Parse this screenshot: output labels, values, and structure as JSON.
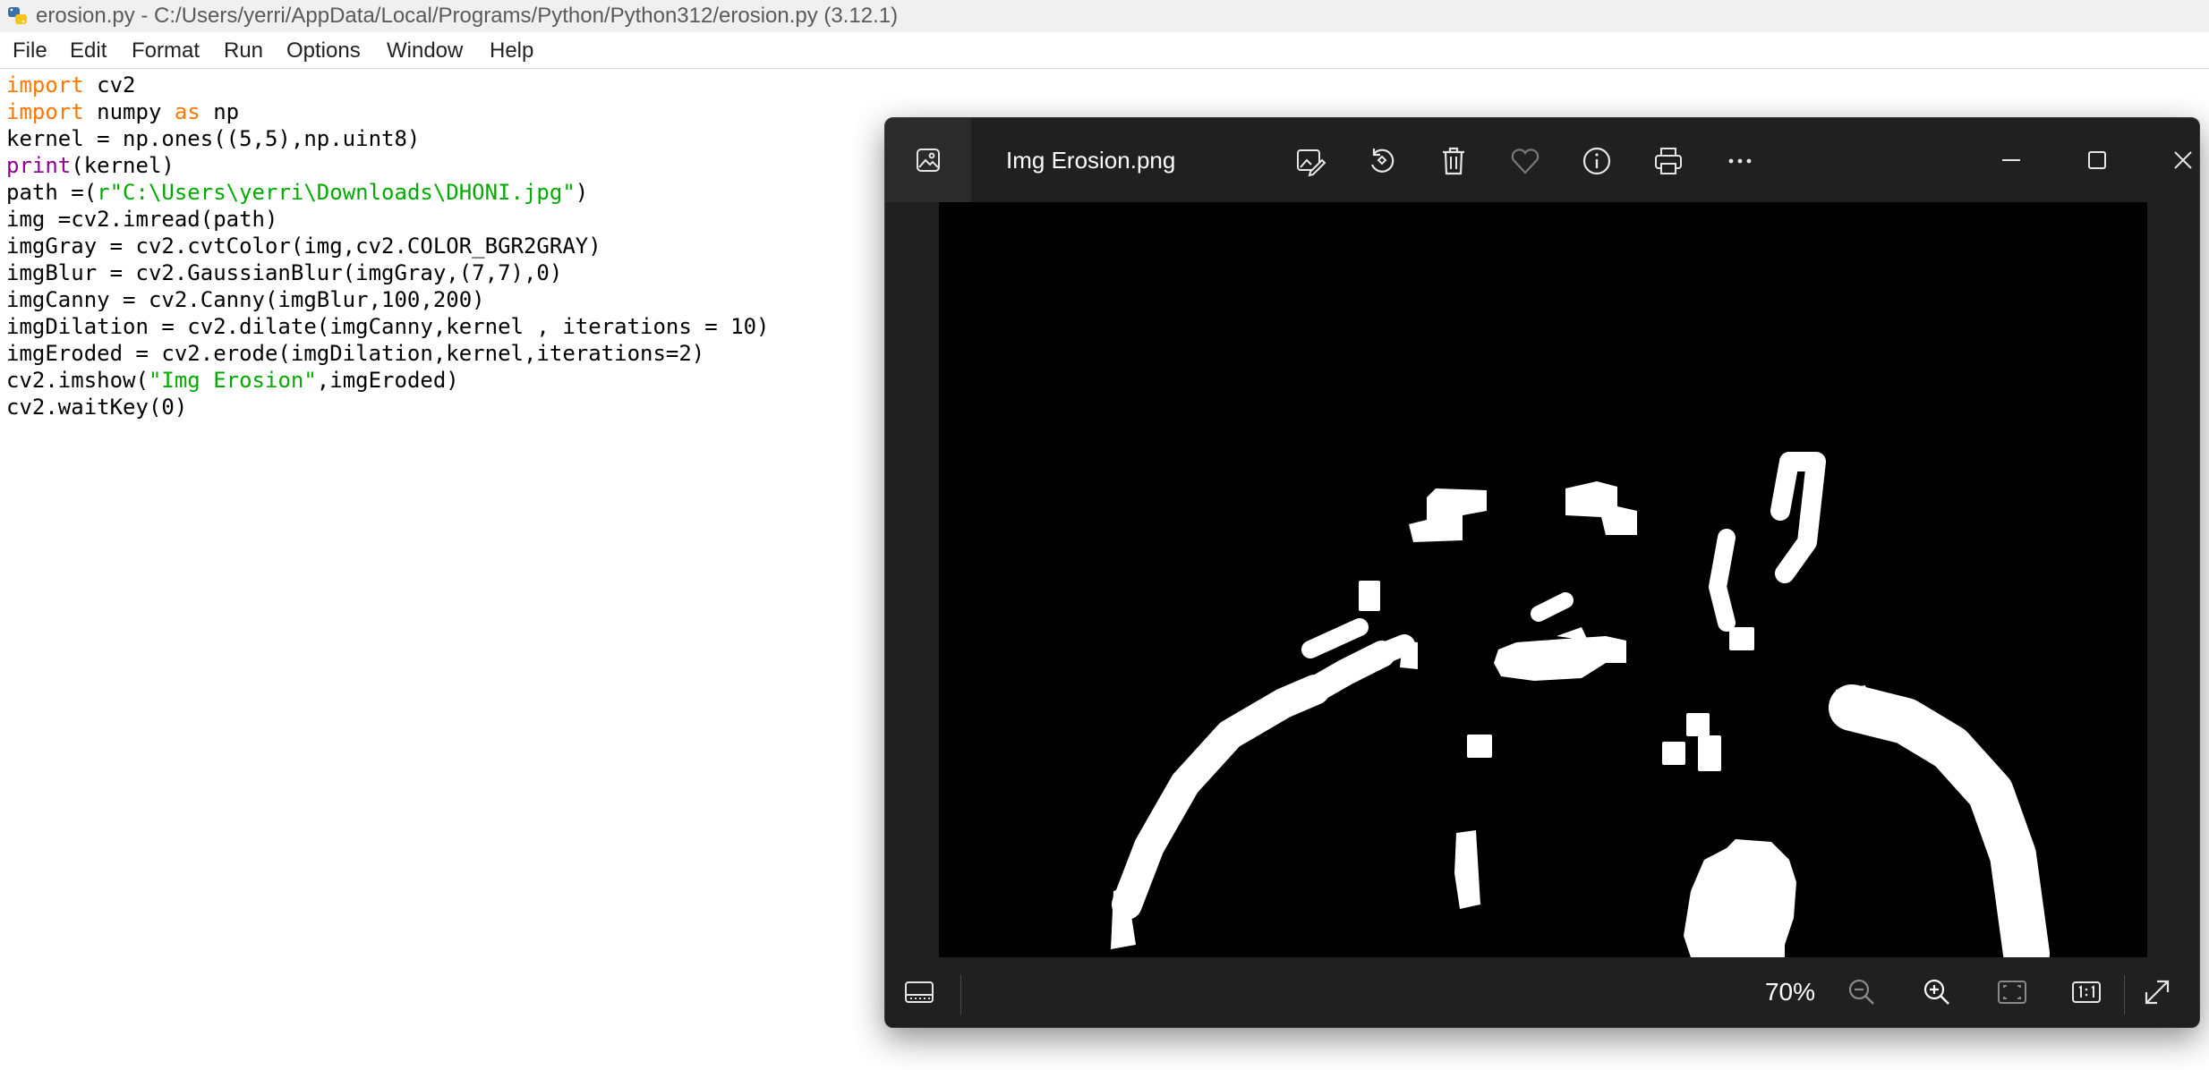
{
  "idle": {
    "title": "erosion.py - C:/Users/yerri/AppData/Local/Programs/Python/Python312/erosion.py (3.12.1)",
    "menu": [
      "File",
      "Edit",
      "Format",
      "Run",
      "Options",
      "Window",
      "Help"
    ],
    "code": [
      [
        {
          "t": "import",
          "c": "kw"
        },
        {
          "t": " cv2"
        }
      ],
      [
        {
          "t": "import",
          "c": "kw"
        },
        {
          "t": " numpy "
        },
        {
          "t": "as",
          "c": "kw"
        },
        {
          "t": " np"
        }
      ],
      [
        {
          "t": "kernel = np.ones((5,5),np.uint8)"
        }
      ],
      [
        {
          "t": "print",
          "c": "bi"
        },
        {
          "t": "(kernel)"
        }
      ],
      [
        {
          "t": "path =("
        },
        {
          "t": "r\"C:\\Users\\yerri\\Downloads\\DHONI.jpg\"",
          "c": "str"
        },
        {
          "t": ")"
        }
      ],
      [
        {
          "t": "img =cv2.imread(path)"
        }
      ],
      [
        {
          "t": "imgGray = cv2.cvtColor(img,cv2.COLOR_BGR2GRAY)"
        }
      ],
      [
        {
          "t": "imgBlur = cv2.GaussianBlur(imgGray,(7,7),0)"
        }
      ],
      [
        {
          "t": "imgCanny = cv2.Canny(imgBlur,100,200)"
        }
      ],
      [
        {
          "t": "imgDilation = cv2.dilate(imgCanny,kernel , iterations = 10)"
        }
      ],
      [
        {
          "t": "imgEroded = cv2.erode(imgDilation,kernel,iterations=2)"
        }
      ],
      [
        {
          "t": "cv2.imshow("
        },
        {
          "t": "\"Img Erosion\"",
          "c": "str"
        },
        {
          "t": ",imgEroded)"
        }
      ],
      [
        {
          "t": "cv2.waitKey(0)"
        }
      ]
    ],
    "colors": {
      "keyword": "#ff7700",
      "builtin": "#900090",
      "string": "#00aa00"
    }
  },
  "viewer": {
    "filename": "Img Erosion.png",
    "zoom": "70%",
    "toolbar_icons": [
      "edit-image-icon",
      "rotate-icon",
      "delete-icon",
      "favorite-icon",
      "info-icon",
      "print-icon",
      "more-icon"
    ],
    "window_icons": [
      "minimize-icon",
      "maximize-icon",
      "close-icon"
    ],
    "bottom_icons": [
      "filmstrip-icon",
      "zoom-out-icon",
      "zoom-in-icon",
      "fit-to-window-icon",
      "actual-size-icon",
      "full-screen-icon"
    ]
  }
}
